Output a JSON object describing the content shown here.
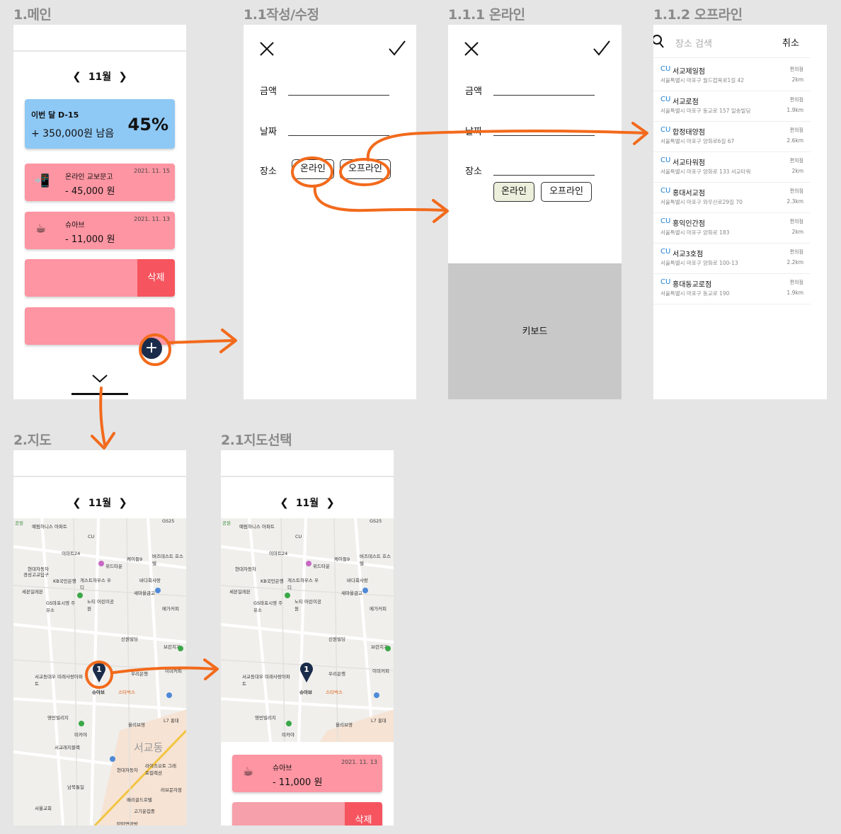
{
  "screens": {
    "main_title": "1.메인",
    "edit_title": "1.1작성/수정",
    "online_title": "1.1.1 온라인",
    "offline_title": "1.1.2 오프라인",
    "map_title": "2.지도",
    "map_select_title": "2.1지도선택"
  },
  "main": {
    "month": "11월",
    "goal": {
      "label": "이번 달 D-15",
      "amount": "+ 350,000원 남음",
      "percent": "45%"
    },
    "transactions": [
      {
        "icon": "phone-icon",
        "glyph": "📲",
        "title": "온라인 교보문고",
        "amount": "- 45,000 원",
        "date": "2021. 11. 15"
      },
      {
        "icon": "coffee-icon",
        "glyph": "☕",
        "title": "슈아브",
        "amount": "- 11,000 원",
        "date": "2021. 11. 13"
      }
    ],
    "delete_label": "삭제",
    "add_glyph": "+"
  },
  "form": {
    "amount_label": "금액",
    "date_label": "날짜",
    "place_label": "장소",
    "online": "온라인",
    "offline": "오프라인",
    "keyboard": "키보드"
  },
  "offline": {
    "search_placeholder": "장소 검색",
    "cancel": "취소",
    "places": [
      {
        "brand": "CU",
        "name": "서교제일점",
        "addr": "서울특별시 마포구 월드컵북로1길 42",
        "cat": "편의점",
        "dist": "2km"
      },
      {
        "brand": "CU",
        "name": "서교로점",
        "addr": "서울특별시 마포구 동교로 157 일송빌딩",
        "cat": "편의점",
        "dist": "1.9km"
      },
      {
        "brand": "CU",
        "name": "합정태양점",
        "addr": "서울특별시 마포구 양화로6길 67",
        "cat": "편의점",
        "dist": "2.6km"
      },
      {
        "brand": "CU",
        "name": "서교타워점",
        "addr": "서울특별시 마포구 양화로 133 서교타워",
        "cat": "편의점",
        "dist": "2km"
      },
      {
        "brand": "CU",
        "name": "홍대서교점",
        "addr": "서울특별시 마포구 와우산로29길 70",
        "cat": "편의점",
        "dist": "2.3km"
      },
      {
        "brand": "CU",
        "name": "홍익인간점",
        "addr": "서울특별시 마포구 양화로 183",
        "cat": "편의점",
        "dist": "2km"
      },
      {
        "brand": "CU",
        "name": "서교3호점",
        "addr": "서울특별시 마포구 양화로 100-13",
        "cat": "편의점",
        "dist": "2.2km"
      },
      {
        "brand": "CU",
        "name": "홍대동교로점",
        "addr": "서울특별시 마포구 동교로 190",
        "cat": "편의점",
        "dist": "1.9km"
      }
    ]
  },
  "map": {
    "month": "11월",
    "pin_number": "1",
    "pin_label": "슈아브",
    "labels": [
      "공원",
      "예림하니스 아파트",
      "CU",
      "GS25",
      "이마트24",
      "케이들9",
      "위드타운",
      "버즈데스트 호스텔",
      "현대자동차",
      "경성고교입구",
      "KB국민은행",
      "게스트하우스 우디",
      "바다회사랑",
      "세븐일레븐",
      "GS마포시영 주유소",
      "노티 어린이공원",
      "새마을금고",
      "메가커피",
      "신원빌딩",
      "브런치가",
      "서교동대우 미래사랑아파트",
      "스타벅스",
      "우리은행",
      "이미커피",
      "올리브영",
      "영빈빌리지",
      "미카야",
      "서교래지블랙",
      "L7 홍대",
      "서교동",
      "라이즈오토 그래프컬렉션",
      "현대자동차",
      "러브문자점",
      "배리골드호텔",
      "남북통일",
      "서울교회",
      "고기운집중",
      "탄탄면공방"
    ],
    "district": "서교동"
  },
  "map_select": {
    "card": {
      "title": "슈아브",
      "amount": "- 11,000 원",
      "date": "2021. 11. 13"
    },
    "delete_label": "삭제"
  },
  "colors": {
    "pink": "#fd95a2",
    "blue": "#8ec8f5",
    "delete": "#f6555f",
    "arrow": "#f26a1c",
    "navy": "#1a2c4a",
    "keyboard": "#c8c8c8"
  }
}
